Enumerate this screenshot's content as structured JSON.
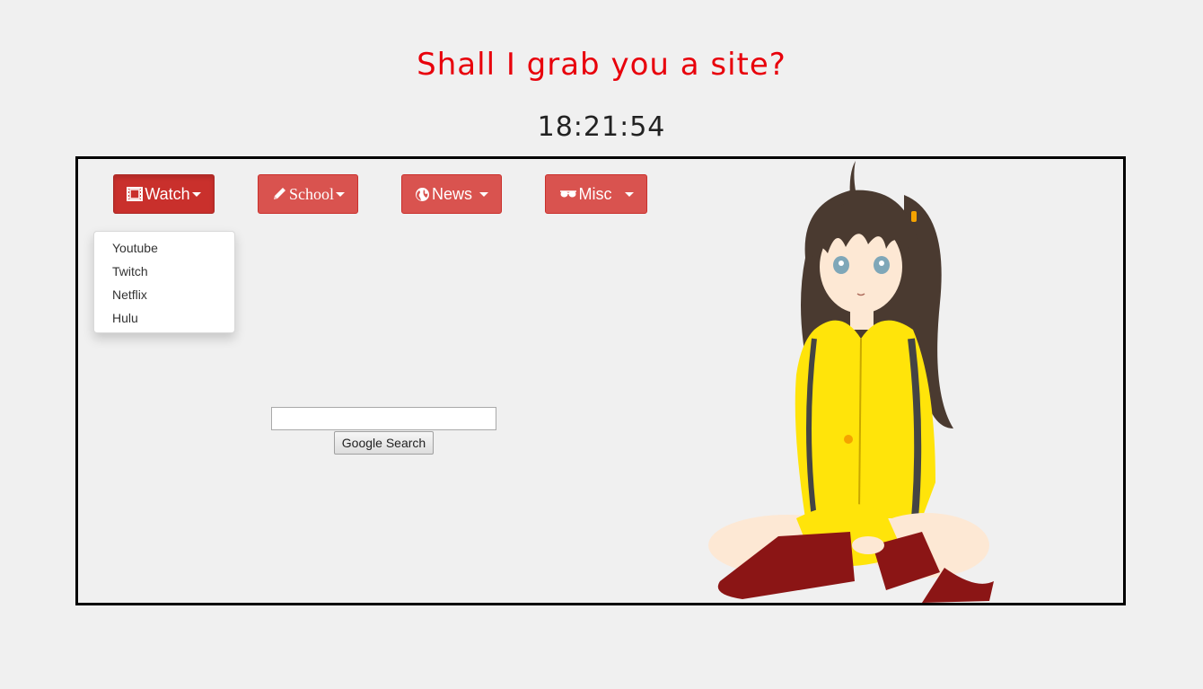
{
  "header": {
    "title": "Shall I grab you a site?",
    "clock": "18:21:54"
  },
  "nav": {
    "watch": {
      "label": "Watch",
      "icon": "film-icon"
    },
    "school": {
      "label": "School",
      "icon": "pencil-icon"
    },
    "news": {
      "label": "News",
      "icon": "globe-icon"
    },
    "misc": {
      "label": "Misc",
      "icon": "sunglasses-icon"
    }
  },
  "watch_menu": {
    "items": [
      "Youtube",
      "Twitch",
      "Netflix",
      "Hulu"
    ]
  },
  "search": {
    "value": "",
    "button_label": "Google Search"
  },
  "colors": {
    "accent": "#d9534f",
    "title": "#e8000b",
    "background": "#f0f0f0"
  }
}
